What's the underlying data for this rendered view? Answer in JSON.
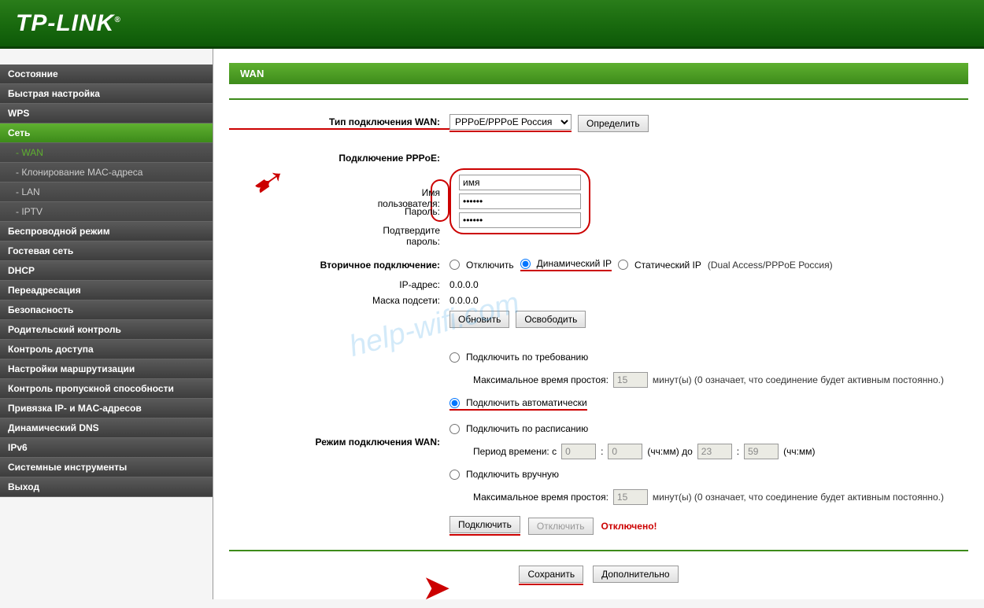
{
  "brand": "TP-LINK",
  "sidebar": {
    "items": [
      {
        "label": "Состояние"
      },
      {
        "label": "Быстрая настройка"
      },
      {
        "label": "WPS"
      },
      {
        "label": "Сеть",
        "active_parent": true
      },
      {
        "label": "Беспроводной режим"
      },
      {
        "label": "Гостевая сеть"
      },
      {
        "label": "DHCP"
      },
      {
        "label": "Переадресация"
      },
      {
        "label": "Безопасность"
      },
      {
        "label": "Родительский контроль"
      },
      {
        "label": "Контроль доступа"
      },
      {
        "label": "Настройки маршрутизации"
      },
      {
        "label": "Контроль пропускной способности"
      },
      {
        "label": "Привязка IP- и MAC-адресов"
      },
      {
        "label": "Динамический DNS"
      },
      {
        "label": "IPv6"
      },
      {
        "label": "Системные инструменты"
      },
      {
        "label": "Выход"
      }
    ],
    "subitems": [
      {
        "label": "- WAN",
        "active": true
      },
      {
        "label": "- Клонирование MAC-адреса"
      },
      {
        "label": "- LAN"
      },
      {
        "label": "- IPTV"
      }
    ]
  },
  "page": {
    "title": "WAN",
    "wan_type_label": "Тип подключения WAN:",
    "wan_type_value": "PPPoE/PPPoE Россия",
    "detect_btn": "Определить",
    "pppoe_header": "Подключение PPPoE:",
    "user_label": "Имя пользователя:",
    "user_value": "имя",
    "pass_label": "Пароль:",
    "pass_value": "••••••",
    "pass2_label": "Подтвердите пароль:",
    "pass2_value": "••••••",
    "sec_conn_label": "Вторичное подключение:",
    "radio_off": "Отключить",
    "radio_dyn": "Динамический IP",
    "radio_static": "Статический IP",
    "sec_hint": "(Dual Access/PPPoE Россия)",
    "ip_label": "IP-адрес:",
    "ip_value": "0.0.0.0",
    "mask_label": "Маска подсети:",
    "mask_value": "0.0.0.0",
    "renew_btn": "Обновить",
    "release_btn": "Освободить",
    "conn_mode_label": "Режим подключения WAN:",
    "radio_demand": "Подключить по требованию",
    "idle_label": "Максимальное время простоя:",
    "idle_value": "15",
    "idle_hint": "минут(ы) (0 означает, что соединение будет активным постоянно.)",
    "radio_auto": "Подключить автоматически",
    "radio_sched": "Подключить по расписанию",
    "sched_label": "Период времени: с",
    "sched_h1": "0",
    "sched_m1": "0",
    "sched_mid": "(чч:мм) до",
    "sched_h2": "23",
    "sched_m2": "59",
    "sched_end": "(чч:мм)",
    "radio_manual": "Подключить вручную",
    "idle2_value": "15",
    "connect_btn": "Подключить",
    "disconnect_btn": "Отключить",
    "status": "Отключено!",
    "save_btn": "Сохранить",
    "advanced_btn": "Дополнительно"
  }
}
